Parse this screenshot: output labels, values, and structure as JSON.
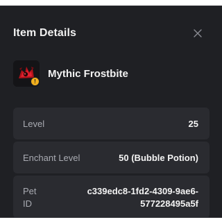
{
  "dialog": {
    "title": "Item Details",
    "close_icon": "close-icon"
  },
  "item": {
    "name": "Mythic Frostbite",
    "thumbnail_icon": "pet-thumbnail",
    "badge_icon": "mythic-badge-icon",
    "badge_color": "#f2b01e"
  },
  "details": [
    {
      "label": "Level",
      "value": "25"
    },
    {
      "label": "Enchant Level",
      "value": "50 (Bubble Potion)"
    },
    {
      "label": "Pet ID",
      "label_line1": "Pet",
      "label_line2": "ID",
      "value_line1": "c339edc8-1fd2-4309-9ae6-",
      "value_line2": "577228495a5f"
    }
  ],
  "colors": {
    "panel": "#1f2024",
    "row": "#2a2b30",
    "text": "#f3f3f3",
    "muted": "#a9abb2"
  }
}
